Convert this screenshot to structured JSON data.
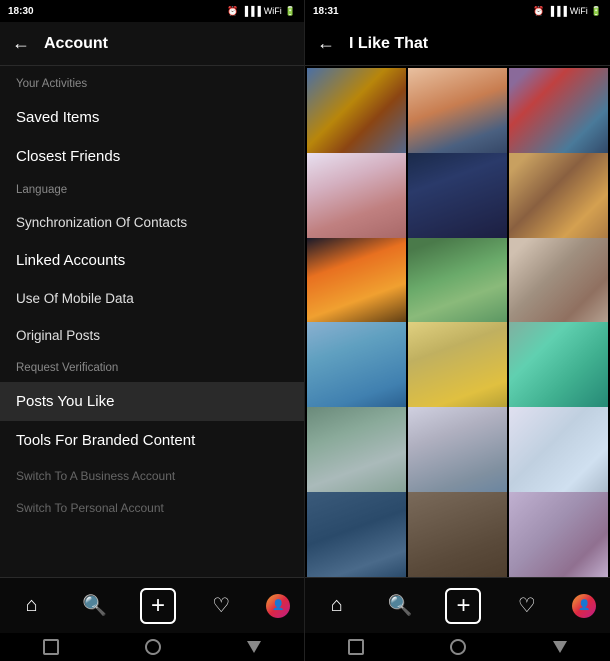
{
  "left": {
    "statusBar": {
      "time": "18:30",
      "icons": "alarm clock battery"
    },
    "header": {
      "back": "←",
      "title": "Account"
    },
    "menuItems": [
      {
        "id": "your-activities",
        "label": "Your Activities",
        "style": "normal"
      },
      {
        "id": "saved-items",
        "label": "Saved Items",
        "style": "large"
      },
      {
        "id": "closest-friends",
        "label": "Closest Friends",
        "style": "large"
      },
      {
        "id": "language",
        "label": "Language",
        "style": "small"
      },
      {
        "id": "sync-contacts",
        "label": "Synchronization Of Contacts",
        "style": "normal"
      },
      {
        "id": "linked-accounts",
        "label": "Linked Accounts",
        "style": "large"
      },
      {
        "id": "mobile-data",
        "label": "Use Of Mobile Data",
        "style": "normal"
      },
      {
        "id": "original-posts",
        "label": "Original Posts",
        "style": "normal"
      },
      {
        "id": "request-verification",
        "label": "Request Verification",
        "style": "small"
      },
      {
        "id": "posts-you-like",
        "label": "Posts You Like",
        "style": "large",
        "active": true
      },
      {
        "id": "branded-content",
        "label": "Tools For Branded Content",
        "style": "large"
      },
      {
        "id": "business-account",
        "label": "Switch To A Business Account",
        "style": "disabled"
      },
      {
        "id": "personal-account",
        "label": "Switch To Personal Account",
        "style": "disabled"
      }
    ],
    "bottomNav": [
      {
        "id": "home",
        "icon": "⌂"
      },
      {
        "id": "search",
        "icon": "🔍"
      },
      {
        "id": "add",
        "icon": "+"
      },
      {
        "id": "heart",
        "icon": "♡"
      },
      {
        "id": "profile",
        "icon": "👤"
      }
    ],
    "gestureBar": [
      "square",
      "circle",
      "triangle"
    ]
  },
  "right": {
    "statusBar": {
      "time": "18:31",
      "icons": "alarm clock battery"
    },
    "header": {
      "back": "←",
      "title": "I Like That"
    },
    "photos": [
      {
        "id": 1,
        "css": "photo-1"
      },
      {
        "id": 2,
        "css": "photo-2"
      },
      {
        "id": 3,
        "css": "photo-3"
      },
      {
        "id": 4,
        "css": "photo-4"
      },
      {
        "id": 5,
        "css": "photo-5"
      },
      {
        "id": 6,
        "css": "photo-6"
      },
      {
        "id": 7,
        "css": "photo-7"
      },
      {
        "id": 8,
        "css": "photo-8"
      },
      {
        "id": 9,
        "css": "photo-9"
      },
      {
        "id": 10,
        "css": "photo-10"
      },
      {
        "id": 11,
        "css": "photo-11"
      },
      {
        "id": 12,
        "css": "photo-12"
      },
      {
        "id": 13,
        "css": "photo-13"
      },
      {
        "id": 14,
        "css": "photo-14"
      },
      {
        "id": 15,
        "css": "photo-15"
      },
      {
        "id": 16,
        "css": "photo-16"
      },
      {
        "id": 17,
        "css": "photo-17"
      },
      {
        "id": 18,
        "css": "photo-18"
      }
    ],
    "bottomNav": [
      {
        "id": "home",
        "icon": "⌂"
      },
      {
        "id": "search",
        "icon": "🔍"
      },
      {
        "id": "add",
        "icon": "+"
      },
      {
        "id": "heart",
        "icon": "♡"
      },
      {
        "id": "profile",
        "icon": "👤"
      }
    ]
  }
}
